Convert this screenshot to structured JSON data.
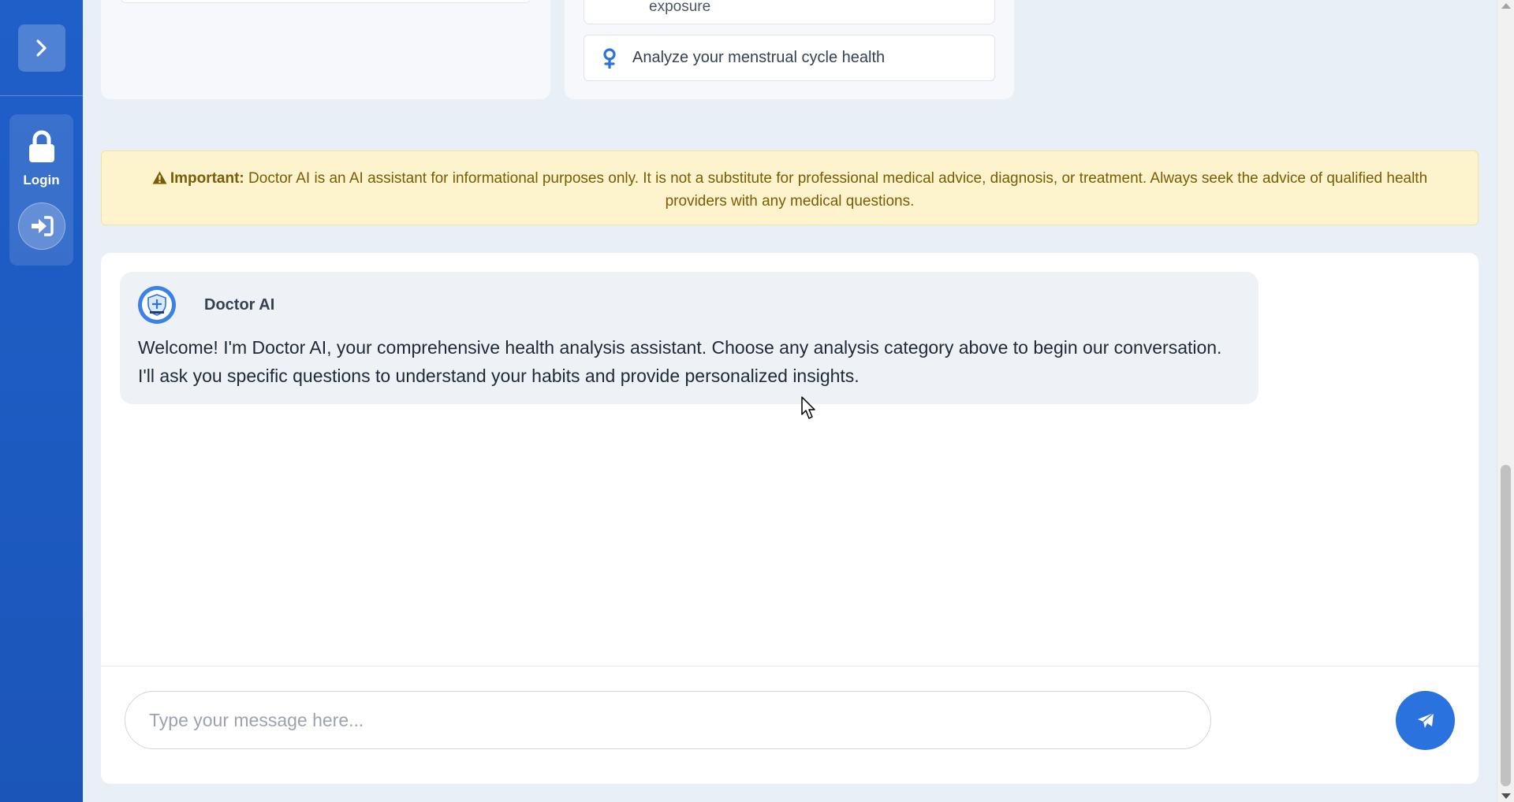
{
  "sidebar": {
    "toggle_icon": "chevron-right-icon",
    "login_label": "Login",
    "lock_icon": "lock-icon",
    "signin_icon": "sign-in-icon"
  },
  "categories": {
    "partial_option_label": "exposure",
    "menstrual_option_label": "Analyze your menstrual cycle health",
    "menstrual_icon": "female-symbol-icon"
  },
  "warning": {
    "label": "Important:",
    "text": "Doctor AI is an AI assistant for informational purposes only. It is not a substitute for professional medical advice, diagnosis, or treatment. Always seek the advice of qualified health providers with any medical questions."
  },
  "chat": {
    "messages": [
      {
        "sender": "Doctor AI",
        "text": "Welcome! I'm Doctor AI, your comprehensive health analysis assistant. Choose any analysis category above to begin our conversation. I'll ask you specific questions to understand your habits and provide personalized insights."
      }
    ],
    "input": {
      "placeholder": "Type your message here...",
      "value": ""
    },
    "send_icon": "paper-plane-icon"
  },
  "colors": {
    "sidebar": "#1f5fc8",
    "accent": "#2a72dd",
    "warning_bg": "#fdf4cd",
    "warning_text": "#7a5c05"
  }
}
